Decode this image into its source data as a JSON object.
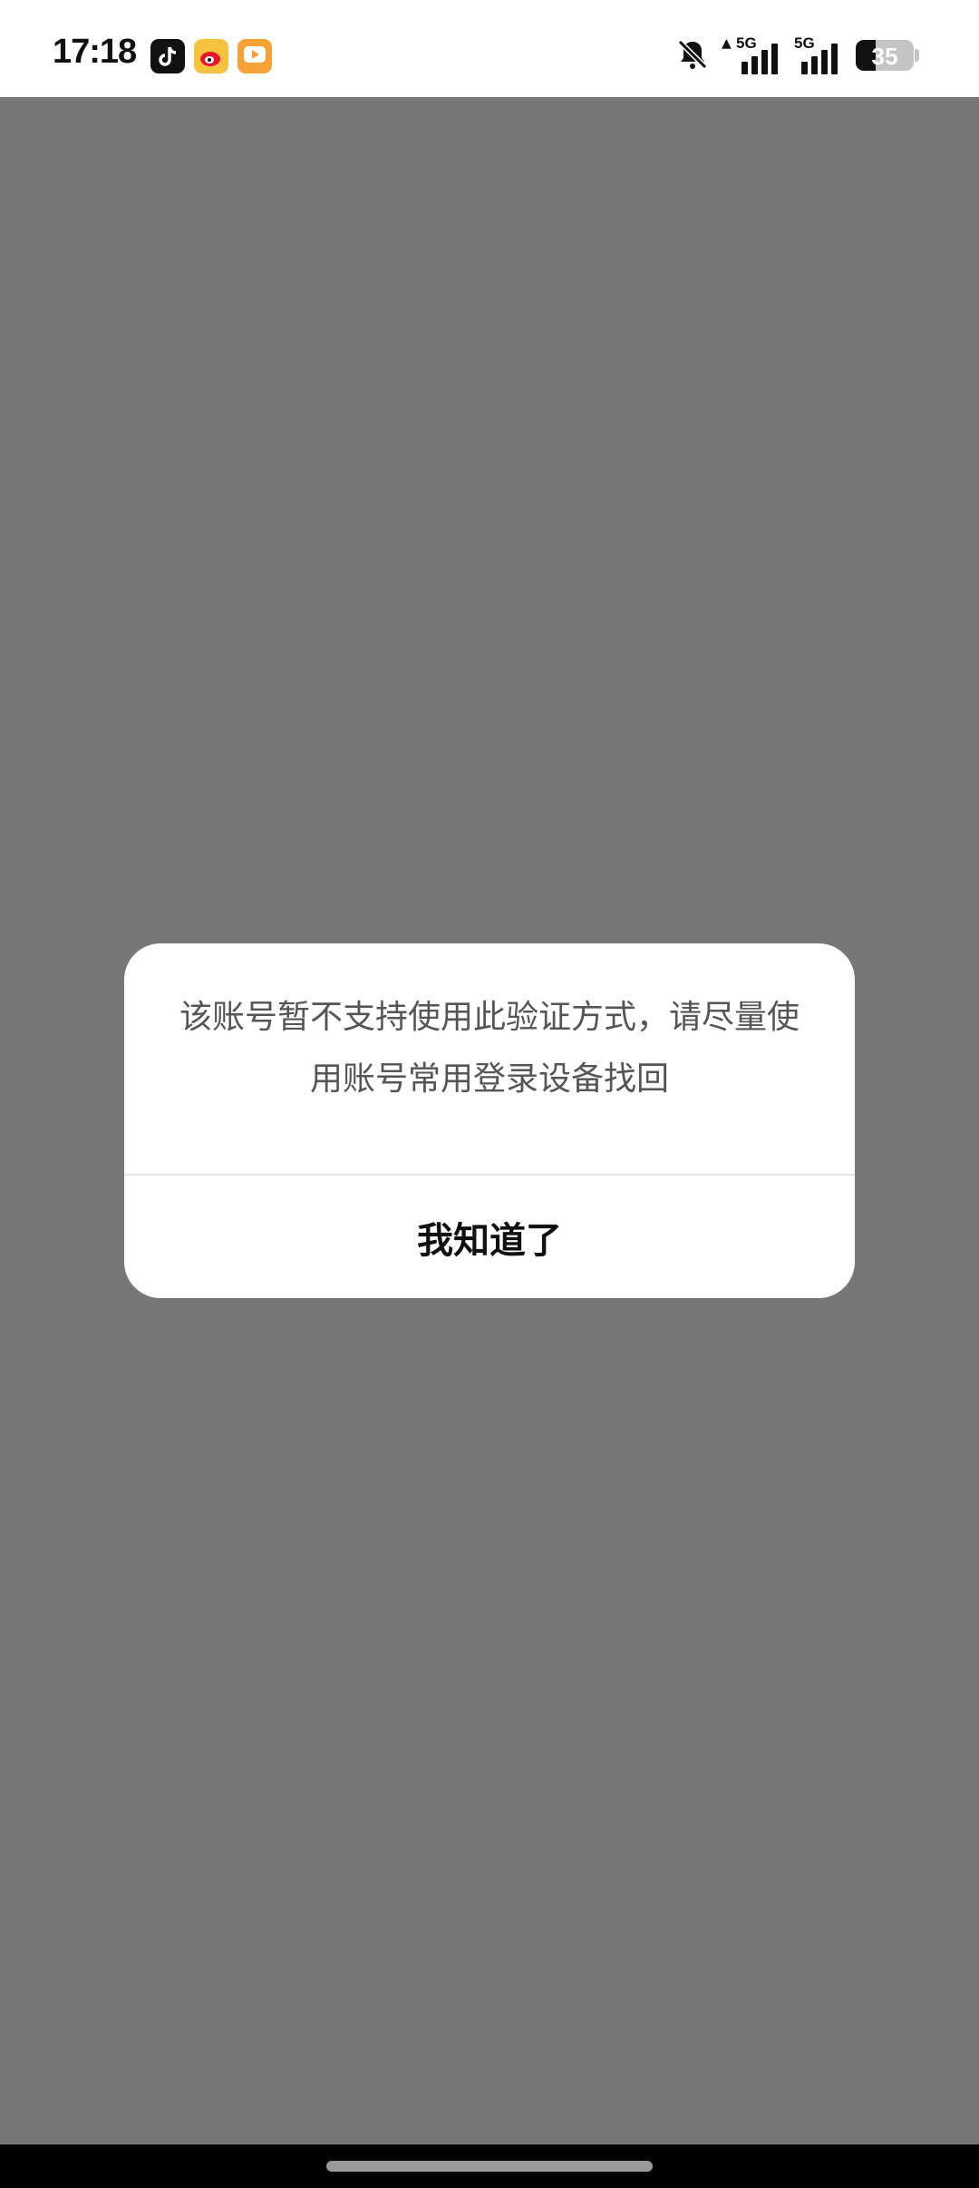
{
  "status_bar": {
    "time": "17:18",
    "apps": [
      {
        "name": "tiktok-icon"
      },
      {
        "name": "weibo-icon"
      },
      {
        "name": "video-app-icon"
      }
    ],
    "signal_1_label": "5G",
    "signal_2_label": "5G",
    "battery_level": "35",
    "battery_percent": 35
  },
  "dialog": {
    "message": "该账号暂不支持使用此验证方式，请尽量使用账号常用登录设备找回",
    "confirm_label": "我知道了"
  },
  "colors": {
    "overlay": "#777777",
    "dialog_bg": "#ffffff",
    "message_text": "#555555",
    "button_text": "#111111"
  }
}
